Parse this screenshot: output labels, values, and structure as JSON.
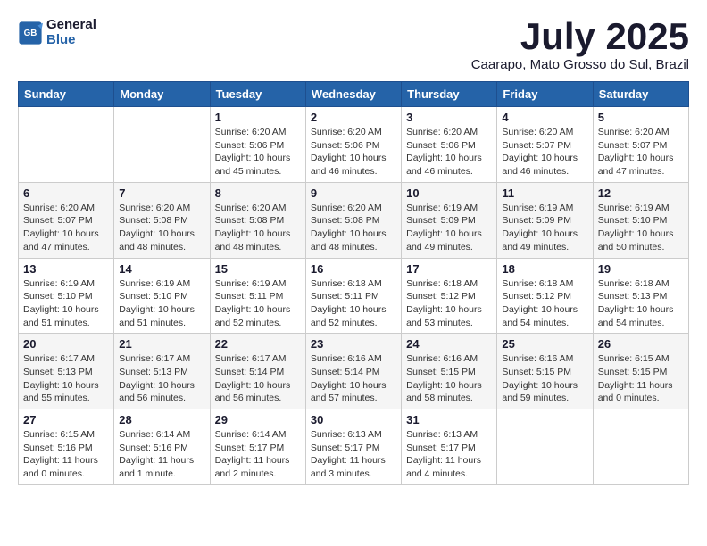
{
  "header": {
    "logo_line1": "General",
    "logo_line2": "Blue",
    "month": "July 2025",
    "location": "Caarapo, Mato Grosso do Sul, Brazil"
  },
  "weekdays": [
    "Sunday",
    "Monday",
    "Tuesday",
    "Wednesday",
    "Thursday",
    "Friday",
    "Saturday"
  ],
  "weeks": [
    [
      {
        "day": "",
        "info": ""
      },
      {
        "day": "",
        "info": ""
      },
      {
        "day": "1",
        "info": "Sunrise: 6:20 AM\nSunset: 5:06 PM\nDaylight: 10 hours\nand 45 minutes."
      },
      {
        "day": "2",
        "info": "Sunrise: 6:20 AM\nSunset: 5:06 PM\nDaylight: 10 hours\nand 46 minutes."
      },
      {
        "day": "3",
        "info": "Sunrise: 6:20 AM\nSunset: 5:06 PM\nDaylight: 10 hours\nand 46 minutes."
      },
      {
        "day": "4",
        "info": "Sunrise: 6:20 AM\nSunset: 5:07 PM\nDaylight: 10 hours\nand 46 minutes."
      },
      {
        "day": "5",
        "info": "Sunrise: 6:20 AM\nSunset: 5:07 PM\nDaylight: 10 hours\nand 47 minutes."
      }
    ],
    [
      {
        "day": "6",
        "info": "Sunrise: 6:20 AM\nSunset: 5:07 PM\nDaylight: 10 hours\nand 47 minutes."
      },
      {
        "day": "7",
        "info": "Sunrise: 6:20 AM\nSunset: 5:08 PM\nDaylight: 10 hours\nand 48 minutes."
      },
      {
        "day": "8",
        "info": "Sunrise: 6:20 AM\nSunset: 5:08 PM\nDaylight: 10 hours\nand 48 minutes."
      },
      {
        "day": "9",
        "info": "Sunrise: 6:20 AM\nSunset: 5:08 PM\nDaylight: 10 hours\nand 48 minutes."
      },
      {
        "day": "10",
        "info": "Sunrise: 6:19 AM\nSunset: 5:09 PM\nDaylight: 10 hours\nand 49 minutes."
      },
      {
        "day": "11",
        "info": "Sunrise: 6:19 AM\nSunset: 5:09 PM\nDaylight: 10 hours\nand 49 minutes."
      },
      {
        "day": "12",
        "info": "Sunrise: 6:19 AM\nSunset: 5:10 PM\nDaylight: 10 hours\nand 50 minutes."
      }
    ],
    [
      {
        "day": "13",
        "info": "Sunrise: 6:19 AM\nSunset: 5:10 PM\nDaylight: 10 hours\nand 51 minutes."
      },
      {
        "day": "14",
        "info": "Sunrise: 6:19 AM\nSunset: 5:10 PM\nDaylight: 10 hours\nand 51 minutes."
      },
      {
        "day": "15",
        "info": "Sunrise: 6:19 AM\nSunset: 5:11 PM\nDaylight: 10 hours\nand 52 minutes."
      },
      {
        "day": "16",
        "info": "Sunrise: 6:18 AM\nSunset: 5:11 PM\nDaylight: 10 hours\nand 52 minutes."
      },
      {
        "day": "17",
        "info": "Sunrise: 6:18 AM\nSunset: 5:12 PM\nDaylight: 10 hours\nand 53 minutes."
      },
      {
        "day": "18",
        "info": "Sunrise: 6:18 AM\nSunset: 5:12 PM\nDaylight: 10 hours\nand 54 minutes."
      },
      {
        "day": "19",
        "info": "Sunrise: 6:18 AM\nSunset: 5:13 PM\nDaylight: 10 hours\nand 54 minutes."
      }
    ],
    [
      {
        "day": "20",
        "info": "Sunrise: 6:17 AM\nSunset: 5:13 PM\nDaylight: 10 hours\nand 55 minutes."
      },
      {
        "day": "21",
        "info": "Sunrise: 6:17 AM\nSunset: 5:13 PM\nDaylight: 10 hours\nand 56 minutes."
      },
      {
        "day": "22",
        "info": "Sunrise: 6:17 AM\nSunset: 5:14 PM\nDaylight: 10 hours\nand 56 minutes."
      },
      {
        "day": "23",
        "info": "Sunrise: 6:16 AM\nSunset: 5:14 PM\nDaylight: 10 hours\nand 57 minutes."
      },
      {
        "day": "24",
        "info": "Sunrise: 6:16 AM\nSunset: 5:15 PM\nDaylight: 10 hours\nand 58 minutes."
      },
      {
        "day": "25",
        "info": "Sunrise: 6:16 AM\nSunset: 5:15 PM\nDaylight: 10 hours\nand 59 minutes."
      },
      {
        "day": "26",
        "info": "Sunrise: 6:15 AM\nSunset: 5:15 PM\nDaylight: 11 hours\nand 0 minutes."
      }
    ],
    [
      {
        "day": "27",
        "info": "Sunrise: 6:15 AM\nSunset: 5:16 PM\nDaylight: 11 hours\nand 0 minutes."
      },
      {
        "day": "28",
        "info": "Sunrise: 6:14 AM\nSunset: 5:16 PM\nDaylight: 11 hours\nand 1 minute."
      },
      {
        "day": "29",
        "info": "Sunrise: 6:14 AM\nSunset: 5:17 PM\nDaylight: 11 hours\nand 2 minutes."
      },
      {
        "day": "30",
        "info": "Sunrise: 6:13 AM\nSunset: 5:17 PM\nDaylight: 11 hours\nand 3 minutes."
      },
      {
        "day": "31",
        "info": "Sunrise: 6:13 AM\nSunset: 5:17 PM\nDaylight: 11 hours\nand 4 minutes."
      },
      {
        "day": "",
        "info": ""
      },
      {
        "day": "",
        "info": ""
      }
    ]
  ]
}
